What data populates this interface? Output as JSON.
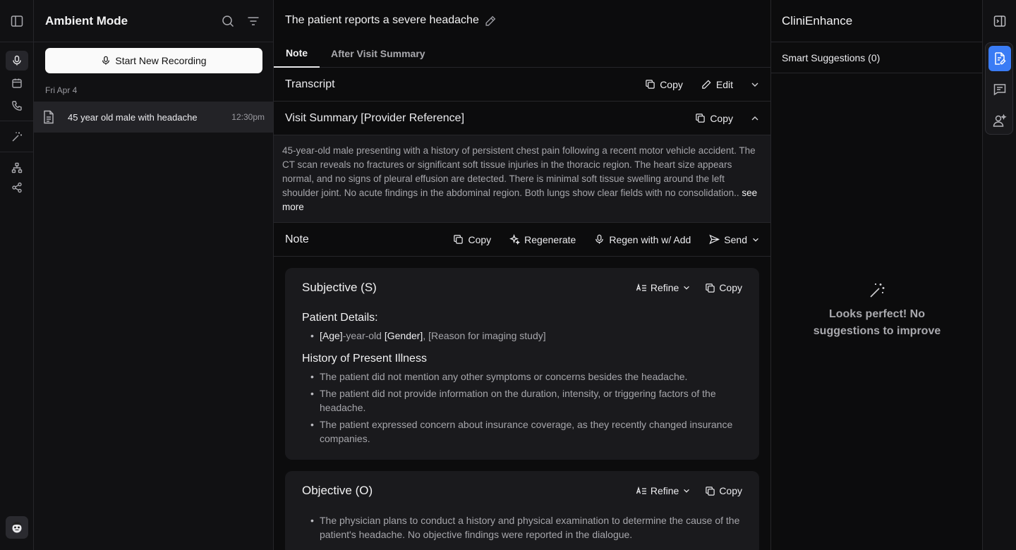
{
  "rail": {
    "icons": [
      "sidebar-toggle-icon",
      "microphone-icon",
      "calendar-icon",
      "phone-icon",
      "magic-wand-icon",
      "sitemap-icon",
      "share-icon"
    ],
    "active": "microphone-icon"
  },
  "list_panel": {
    "title": "Ambient Mode",
    "record_button": "Start New Recording",
    "date_group": "Fri Apr 4",
    "recordings": [
      {
        "name": "45 year old male with headache",
        "time": "12:30pm"
      }
    ]
  },
  "main": {
    "title": "The patient reports a severe headache",
    "tabs": [
      "Note",
      "After Visit Summary"
    ],
    "active_tab": "Note",
    "transcript": {
      "title": "Transcript",
      "copy": "Copy",
      "edit": "Edit"
    },
    "visit_summary": {
      "title": "Visit Summary [Provider Reference]",
      "copy": "Copy",
      "text": "45-year-old male presenting with a history of persistent chest pain following a recent motor vehicle accident. The CT scan reveals no fractures or significant soft tissue injuries in the thoracic region. The heart size appears normal, and no signs of pleural effusion are detected. There is minimal soft tissue swelling around the left shoulder joint. No acute findings in the abdominal region. Both lungs show clear fields with no consolidation..",
      "see_more": "see more"
    },
    "note_bar": {
      "title": "Note",
      "copy": "Copy",
      "regenerate": "Regenerate",
      "regen_add": "Regen with w/ Add",
      "send": "Send"
    },
    "subjective": {
      "title": "Subjective (S)",
      "refine": "Refine",
      "copy": "Copy",
      "patient_details_heading": "Patient Details:",
      "age": "[Age]",
      "age_suffix": "-year-old ",
      "gender": "[Gender]",
      "reason": ", [Reason for imaging study]",
      "hpi_heading": "History of Present Illness",
      "hpi": [
        "The patient did not mention any other symptoms or concerns besides the headache.",
        "The patient did not provide information on the duration, intensity, or triggering factors of the headache.",
        "The patient expressed concern about insurance coverage, as they recently changed insurance companies."
      ]
    },
    "objective": {
      "title": "Objective (O)",
      "refine": "Refine",
      "copy": "Copy",
      "items": [
        "The physician plans to conduct a history and physical examination to determine the cause of the patient's headache. No objective findings were reported in the dialogue."
      ]
    }
  },
  "right_panel": {
    "title": "CliniEnhance",
    "suggestions_label": "Smart Suggestions (0)",
    "empty_message": "Looks perfect! No suggestions to improve"
  },
  "right_rail": {
    "icons": [
      "collapse-panel-icon",
      "document-edit-icon",
      "chat-icon",
      "user-assist-icon"
    ],
    "active": "document-edit-icon"
  },
  "colors": {
    "accent": "#3a7cf5",
    "background": "#0c0c0d",
    "card": "#1a1a1d"
  }
}
